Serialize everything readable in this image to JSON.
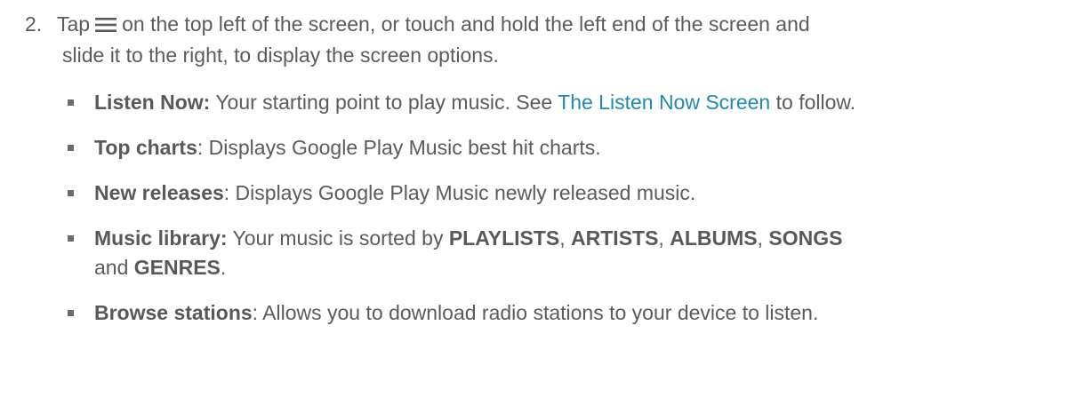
{
  "step": {
    "number": "2.",
    "text_before_icon": "Tap",
    "icon": "menu-icon",
    "line1_after_icon": "on the top left of the screen, or touch and hold the left end of the screen and",
    "line2": "slide it to the right, to display the screen options."
  },
  "bullets": [
    {
      "term": "Listen Now:",
      "text_a": " Your starting point to play music. See ",
      "link": "The Listen Now Screen",
      "text_b": " to follow."
    },
    {
      "term": "Top charts",
      "text_a": ": Displays Google Play Music best hit charts."
    },
    {
      "term": "New releases",
      "text_a": ": Displays Google Play Music newly released music."
    },
    {
      "term": "Music library:",
      "text_a": " Your music is sorted by ",
      "cat1": "PLAYLISTS",
      "sep1": ", ",
      "cat2": "ARTISTS",
      "sep2": ", ",
      "cat3": "ALBUMS",
      "sep3": ", ",
      "cat4": "SONGS",
      "line2_prefix": "and ",
      "cat5": "GENRES",
      "line2_suffix": "."
    },
    {
      "term": "Browse stations",
      "text_a": ": Allows you to download radio stations to your device to listen."
    }
  ],
  "colors": {
    "text": "#5b5b5b",
    "link": "#1f8ab3",
    "bullet": "#6b6b6b"
  }
}
